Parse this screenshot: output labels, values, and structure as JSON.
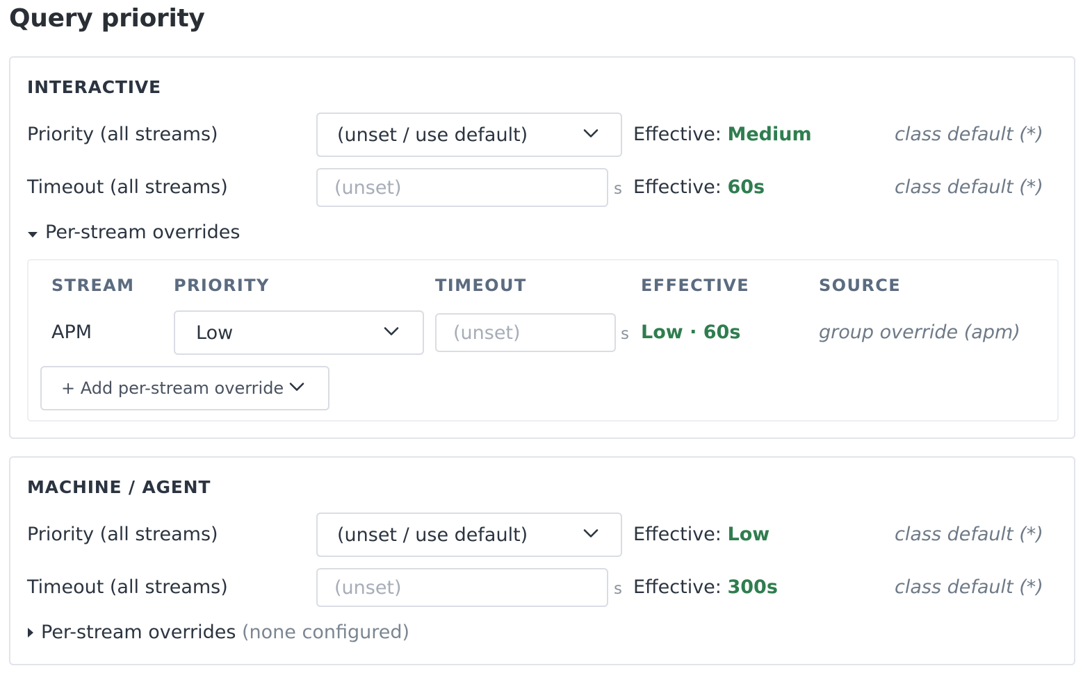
{
  "page": {
    "title": "Query priority"
  },
  "sections": [
    {
      "title": "INTERACTIVE",
      "priority": {
        "label": "Priority (all streams)",
        "value": "(unset / use default)",
        "effective_prefix": "Effective: ",
        "effective_value": "Medium",
        "source": "class default (*)"
      },
      "timeout": {
        "label": "Timeout (all streams)",
        "placeholder": "(unset)",
        "unit": "s",
        "effective_prefix": "Effective: ",
        "effective_value": "60s",
        "source": "class default (*)"
      },
      "overrides": {
        "toggle_label": "Per-stream overrides",
        "expanded": true,
        "columns": [
          "STREAM",
          "PRIORITY",
          "TIMEOUT",
          "EFFECTIVE",
          "SOURCE"
        ],
        "rows": [
          {
            "stream": "APM",
            "priority": "Low",
            "timeout_placeholder": "(unset)",
            "unit": "s",
            "effective": "Low · 60s",
            "source": "group override (apm)"
          }
        ],
        "add_button": "+ Add per-stream override"
      }
    },
    {
      "title": "MACHINE / AGENT",
      "priority": {
        "label": "Priority (all streams)",
        "value": "(unset / use default)",
        "effective_prefix": "Effective: ",
        "effective_value": "Low",
        "source": "class default (*)"
      },
      "timeout": {
        "label": "Timeout (all streams)",
        "placeholder": "(unset)",
        "unit": "s",
        "effective_prefix": "Effective: ",
        "effective_value": "300s",
        "source": "class default (*)"
      },
      "overrides": {
        "toggle_label": "Per-stream overrides",
        "toggle_note": "(none configured)",
        "expanded": false
      }
    }
  ],
  "colors": {
    "effective_green": "#2f7d4f",
    "header_slate": "#5b6b80",
    "source_gray": "#6e7a87",
    "border": "#d9dde3"
  },
  "icons": {
    "select_chevron": "chevron-down-icon",
    "expanded_caret": "caret-down-icon",
    "collapsed_caret": "caret-right-icon"
  }
}
